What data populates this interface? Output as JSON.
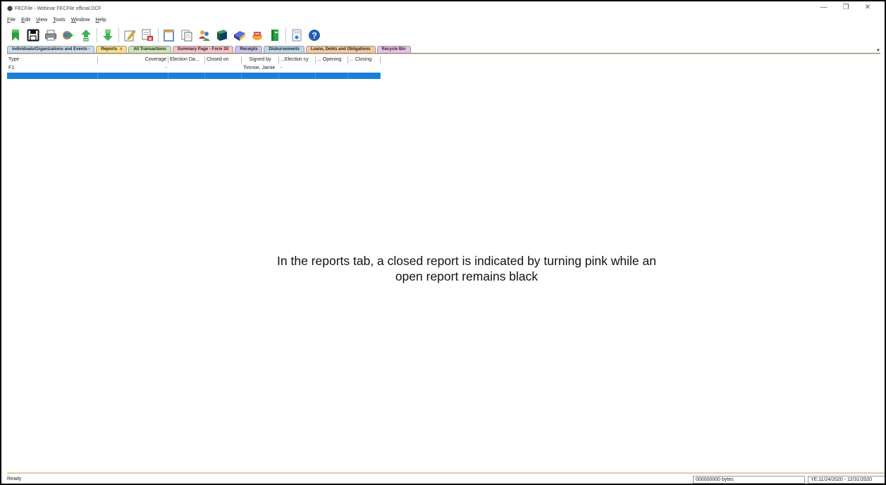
{
  "window": {
    "title": "FECFile - Webinar FECFile official.DCF",
    "controls": [
      "—",
      "❐",
      "✕"
    ]
  },
  "menu": [
    "File",
    "Edit",
    "View",
    "Tools",
    "Window",
    "Help"
  ],
  "toolbar_icons": [
    "new-report-icon",
    "save-icon",
    "print-icon",
    "import-icon",
    "upload-icon",
    "download-icon",
    "edit-icon",
    "delete-icon",
    "copy-icon",
    "paste-icon",
    "contacts-icon",
    "book-icon",
    "envelope-icon",
    "transfer-icon",
    "book-green-icon",
    "calculator-icon",
    "help-icon"
  ],
  "tabs": [
    {
      "label": "Individuals/Organizations and Events -",
      "color": "#c9ddf0",
      "closable": false
    },
    {
      "label": "Reports",
      "color": "#f4dd86",
      "closable": true,
      "active": true
    },
    {
      "label": "All Transactions",
      "color": "#cbe3b4",
      "closable": false
    },
    {
      "label": "Summary Page - Form 3X",
      "color": "#f7c0c8",
      "closable": false
    },
    {
      "label": "Receipts",
      "color": "#c9c2ef",
      "closable": false
    },
    {
      "label": "Disbursements",
      "color": "#b8d7ee",
      "closable": false
    },
    {
      "label": "Loans, Debts and Obligations",
      "color": "#f5c9a0",
      "closable": false
    },
    {
      "label": "Recycle Bin",
      "color": "#e9c0e8",
      "closable": false
    }
  ],
  "tab_close_symbol": "x",
  "grid": {
    "columns": [
      "Type",
      "Coverage",
      "Election Da...",
      "Closed on",
      "Signed by",
      "...Election cy",
      "... Opening",
      "... Closing"
    ],
    "rows": [
      [
        "F1",
        "-",
        "",
        "",
        "Timmie, Jamie",
        "-",
        "",
        ""
      ],
      [
        "",
        "",
        "",
        "",
        "",
        "",
        "",
        ""
      ]
    ]
  },
  "caption": {
    "line1": "In the reports tab, a closed report is indicated by turning pink while an",
    "line2": "open report remains black"
  },
  "status": {
    "text": "Ready",
    "bytes": "000000000 bytes",
    "ye": "YE:11/24/2020 - 12/31/2020"
  },
  "colors": {
    "selection": "#1a7fd6",
    "status_border": "#e5c9a0"
  }
}
